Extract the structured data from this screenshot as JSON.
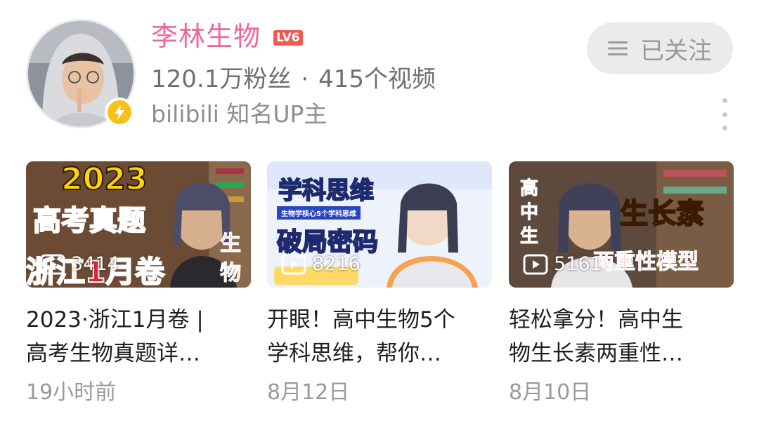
{
  "channel": {
    "name": "李林生物",
    "level": "LV6",
    "stats": {
      "fans": "120.1万粉丝",
      "separator": "·",
      "videos": "415个视频"
    },
    "certification": "bilibili 知名UP主",
    "avatar_icon": "person-avatar-icon",
    "badge_icon": "lightning-verify-icon",
    "colors": {
      "name": "#f0669a",
      "level_badge": "#ee5a4f",
      "verify_badge": "#f7c218"
    }
  },
  "follow_button": {
    "label": "已关注",
    "icon": "menu-lines-icon"
  },
  "more_button": {
    "icon": "more-vertical-icon"
  },
  "videos": [
    {
      "thumb_text": [
        "2023",
        "高考真题",
        "浙江1月卷",
        "生",
        "物"
      ],
      "views": "3414",
      "title_line1": "2023·浙江1月卷 |",
      "title_line2": "高考生物真题详…",
      "date": "19小时前"
    },
    {
      "thumb_text": [
        "学科思维",
        "生物学核心5个学科思维",
        "破局密码"
      ],
      "views": "8216",
      "title_line1": "开眼！高中生物5个",
      "title_line2": "学科思维，帮你…",
      "date": "8月12日"
    },
    {
      "thumb_text": [
        "高",
        "中",
        "生",
        "生长素",
        "两重性模型"
      ],
      "views": "5161",
      "title_line1": "轻松拿分！高中生",
      "title_line2": "物生长素两重性…",
      "date": "8月10日"
    }
  ]
}
